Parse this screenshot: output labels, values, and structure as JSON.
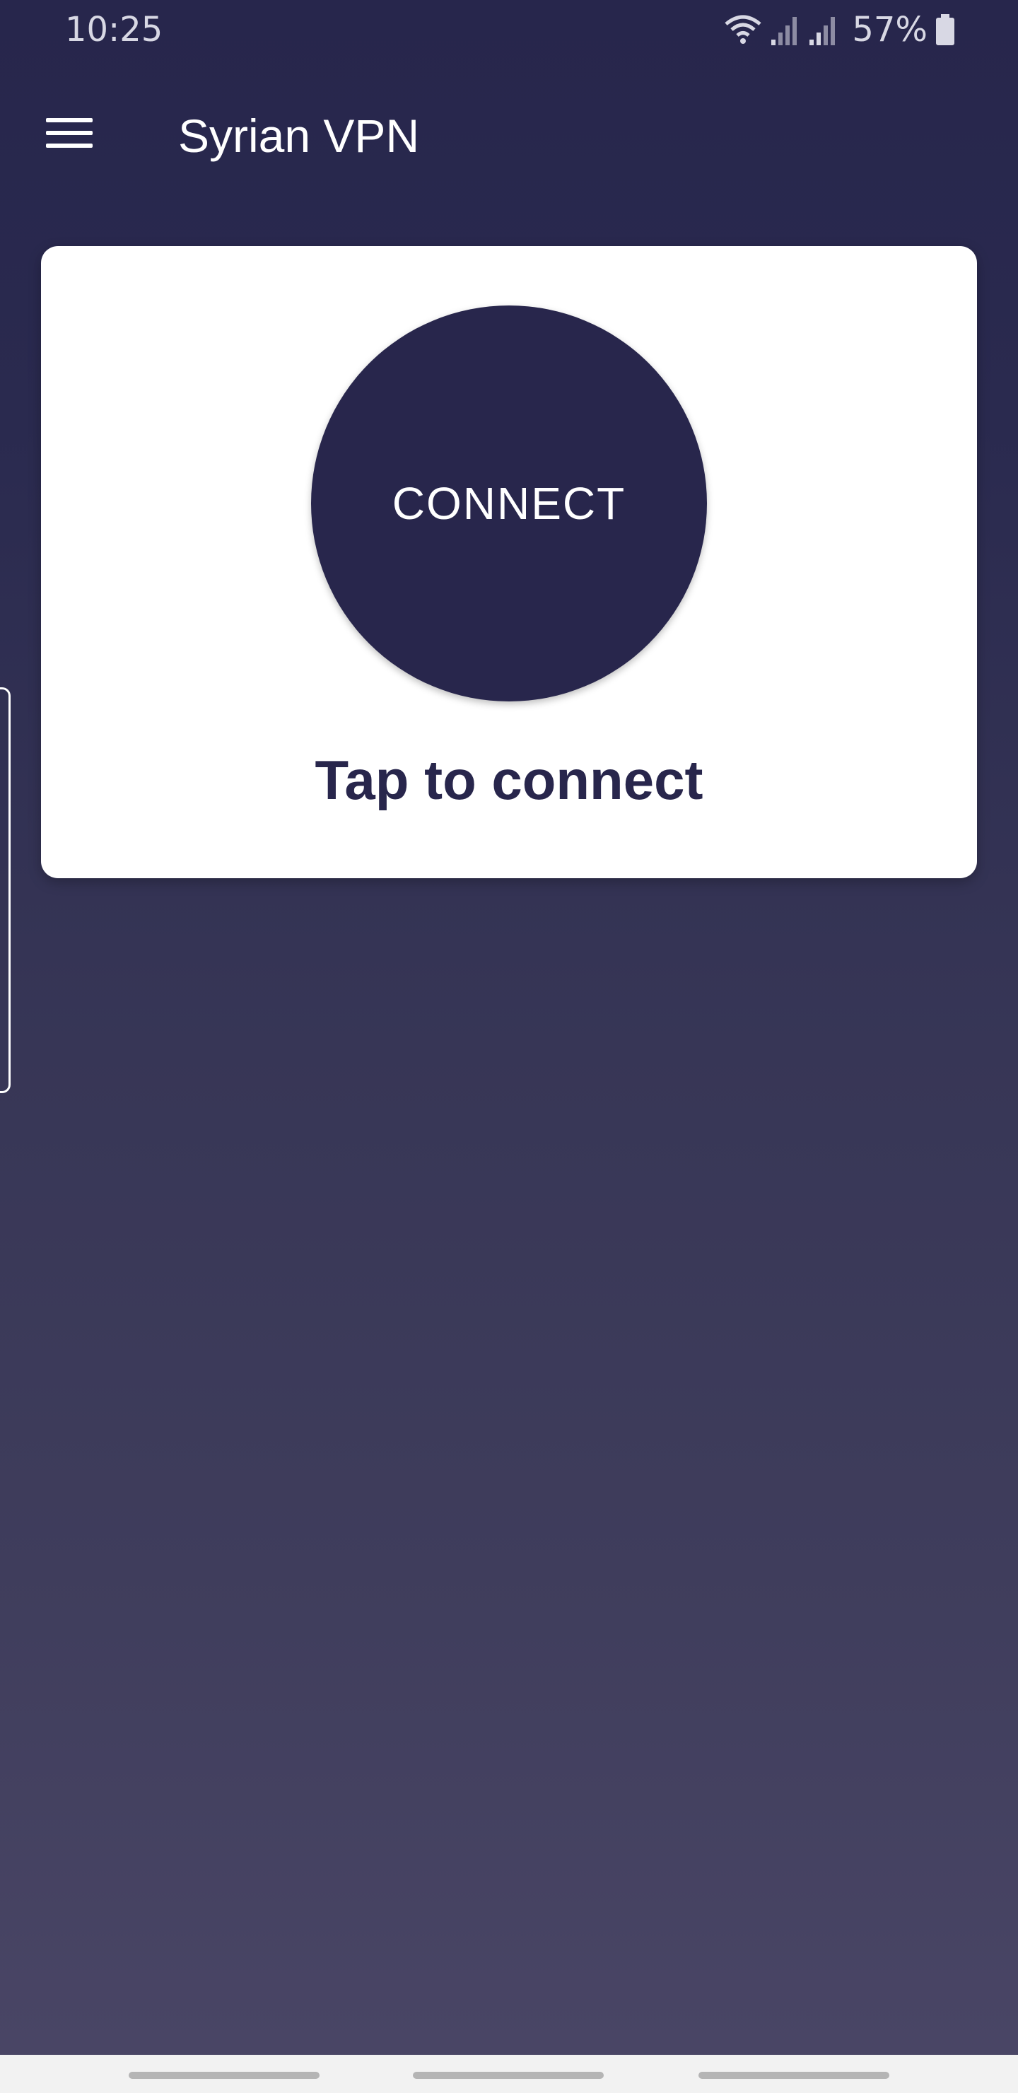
{
  "status_bar": {
    "time": "10:25",
    "battery_percent": "57%",
    "icons": [
      "wifi-icon",
      "signal-icon",
      "signal-icon",
      "battery-icon"
    ]
  },
  "app_bar": {
    "menu_icon": "hamburger-menu-icon",
    "title": "Syrian VPN"
  },
  "card": {
    "connect_label": "CONNECT",
    "status_text": "Tap to connect"
  },
  "nav_bar": {
    "buttons": [
      "recent-apps",
      "home",
      "back"
    ]
  },
  "colors": {
    "background_top": "#27264c",
    "background_bottom": "#4a4666",
    "accent": "#28264c",
    "card": "#ffffff"
  }
}
